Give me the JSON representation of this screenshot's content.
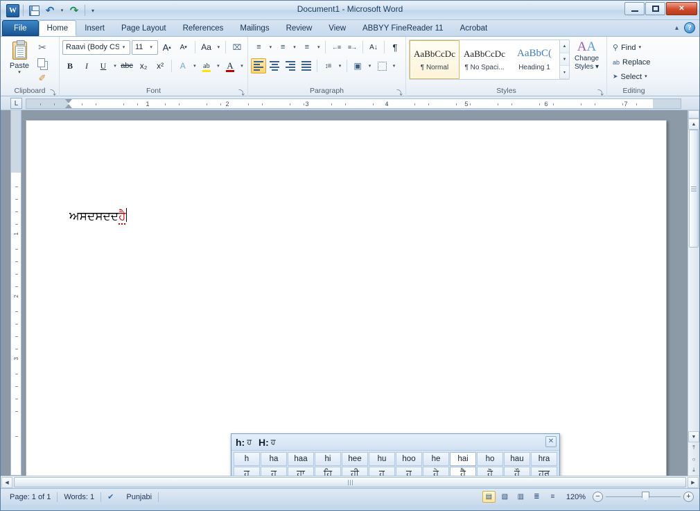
{
  "window": {
    "title": "Document1 - Microsoft Word",
    "quick_access": [
      {
        "name": "word-logo",
        "label": "W"
      },
      {
        "name": "save",
        "label": "Save"
      },
      {
        "name": "undo",
        "label": "↶"
      },
      {
        "name": "redo",
        "label": "↷"
      },
      {
        "name": "customize-qat",
        "label": "▾"
      }
    ],
    "controls": {
      "minimize": "Minimize",
      "maximize": "Maximize",
      "close": "✕"
    }
  },
  "ribbon": {
    "tabs": [
      {
        "label": "File",
        "active": false,
        "file": true
      },
      {
        "label": "Home",
        "active": true
      },
      {
        "label": "Insert",
        "active": false
      },
      {
        "label": "Page Layout",
        "active": false
      },
      {
        "label": "References",
        "active": false
      },
      {
        "label": "Mailings",
        "active": false
      },
      {
        "label": "Review",
        "active": false
      },
      {
        "label": "View",
        "active": false
      },
      {
        "label": "ABBYY FineReader 11",
        "active": false
      },
      {
        "label": "Acrobat",
        "active": false
      }
    ],
    "collapse_label": "▴",
    "help_label": "?",
    "groups": {
      "clipboard": {
        "label": "Clipboard",
        "paste_label": "Paste",
        "paste_caret": "▾",
        "cut_label": "✂",
        "copy_label": "Copy",
        "format_painter_label": "✐",
        "launcher": "⤵"
      },
      "font": {
        "label": "Font",
        "font_name": "Raavi (Body CS)",
        "font_size": "11",
        "caret": "▾",
        "grow_font": "A",
        "shrink_font": "A",
        "change_case": "Aa",
        "clear_formatting": "⌧",
        "bold": "B",
        "italic": "I",
        "underline": "U",
        "strikethrough": "abc",
        "subscript": "x₂",
        "superscript": "x²",
        "text_effects": "A",
        "highlight": "ab",
        "font_color": "A",
        "launcher": "⤵"
      },
      "paragraph": {
        "label": "Paragraph",
        "bullets": "≡",
        "numbering": "≡",
        "multilevel": "≡",
        "decrease_indent": "←≡",
        "increase_indent": "≡→",
        "sort": "A↓",
        "show_marks": "¶",
        "align_left": "Align Left",
        "center": "Center",
        "align_right": "Align Right",
        "justify": "Justify",
        "line_spacing": "↕≡",
        "shading": "▣",
        "borders": "▦",
        "caret": "▾",
        "launcher": "⤵"
      },
      "styles": {
        "label": "Styles",
        "items": [
          {
            "preview": "AaBbCcDc",
            "name": "¶ Normal",
            "selected": true
          },
          {
            "preview": "AaBbCcDc",
            "name": "¶ No Spaci...",
            "selected": false
          },
          {
            "preview": "AaBbC(",
            "name": "Heading 1",
            "selected": false,
            "heading": true
          }
        ],
        "scroll_up": "▲",
        "scroll_down": "▼",
        "more": "▾",
        "change_styles_label": "Change\nStyles",
        "change_styles_line1": "Change",
        "change_styles_line2": "Styles ▾",
        "launcher": "⤵"
      },
      "editing": {
        "label": "Editing",
        "find": "Find",
        "find_caret": "▾",
        "replace": "Replace",
        "select": "Select",
        "select_caret": "▾",
        "find_icon": "⚲",
        "replace_icon": "ab",
        "select_icon": "➤"
      }
    }
  },
  "ruler": {
    "tab_selector": "L",
    "horizontal_marks": [
      "1",
      "2",
      "3",
      "4",
      "5",
      "6",
      "7"
    ],
    "vertical_marks": [
      "1",
      "2",
      "3"
    ]
  },
  "document": {
    "committed_text": "ਅਸਦਸਦਦ",
    "composing_text": "ਹੈ"
  },
  "ime_popup": {
    "header_lower_key": "h:",
    "header_lower_value": "ਹ",
    "header_upper_key": "H:",
    "header_upper_value": "ਹ",
    "close_label": "✕",
    "candidates": [
      {
        "roman": "h",
        "gurmukhi": "ਹ",
        "selected": false
      },
      {
        "roman": "ha",
        "gurmukhi": "ਹ",
        "selected": false
      },
      {
        "roman": "haa",
        "gurmukhi": "ਹਾ",
        "selected": false
      },
      {
        "roman": "hi",
        "gurmukhi": "ਹਿ",
        "selected": false
      },
      {
        "roman": "hee",
        "gurmukhi": "ਹੀ",
        "selected": false
      },
      {
        "roman": "hu",
        "gurmukhi": "ਹੁ",
        "selected": false
      },
      {
        "roman": "hoo",
        "gurmukhi": "ਹੂ",
        "selected": false
      },
      {
        "roman": "he",
        "gurmukhi": "ਹੇ",
        "selected": false
      },
      {
        "roman": "hai",
        "gurmukhi": "ਹੈ",
        "selected": true
      },
      {
        "roman": "ho",
        "gurmukhi": "ਹੋ",
        "selected": false
      },
      {
        "roman": "hau",
        "gurmukhi": "ਹੌ",
        "selected": false
      },
      {
        "roman": "hra",
        "gurmukhi": "ਹ੍ਰ",
        "selected": false
      }
    ]
  },
  "status_bar": {
    "page": "Page: 1 of 1",
    "words": "Words: 1",
    "proofing_icon": "✔",
    "language": "Punjabi",
    "views": [
      {
        "name": "print-layout",
        "glyph": "▤",
        "selected": true
      },
      {
        "name": "full-screen-reading",
        "glyph": "▧",
        "selected": false
      },
      {
        "name": "web-layout",
        "glyph": "▥",
        "selected": false
      },
      {
        "name": "outline",
        "glyph": "≣",
        "selected": false
      },
      {
        "name": "draft",
        "glyph": "≡",
        "selected": false
      }
    ],
    "zoom_level": "120%",
    "zoom_out": "−",
    "zoom_in": "+"
  },
  "scrollbars": {
    "up_arrow": "▲",
    "down_arrow": "▼",
    "left_arrow": "◀",
    "right_arrow": "▶",
    "previous_page": "⤒",
    "browse_object": "○",
    "next_page": "⤓"
  }
}
